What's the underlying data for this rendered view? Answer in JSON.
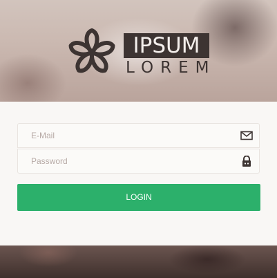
{
  "brand": {
    "name": "IPSUM",
    "tagline": "LOREM"
  },
  "form": {
    "email": {
      "placeholder": "E-Mail",
      "value": "",
      "icon": "envelope-icon"
    },
    "password": {
      "placeholder": "Password",
      "value": "",
      "icon": "lock-icon"
    },
    "login_label": "LOGIN"
  },
  "colors": {
    "accent": "#2cb06b",
    "brand_dark": "#3d3432",
    "panel": "#f9f7f5"
  }
}
